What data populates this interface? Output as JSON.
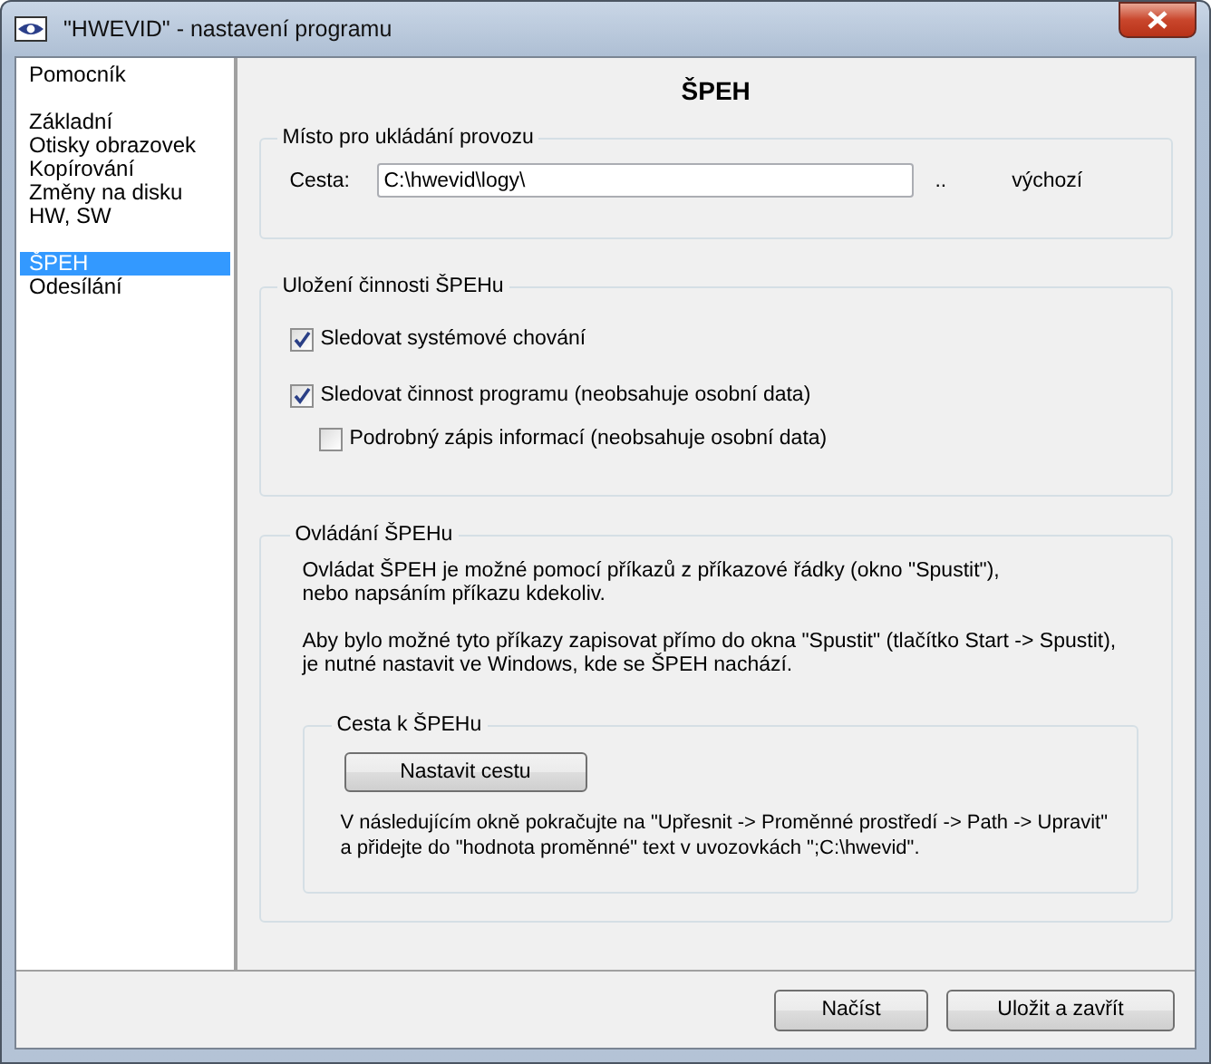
{
  "window": {
    "title": "\"HWEVID\" - nastavení programu"
  },
  "sidebar": {
    "groups": [
      [
        {
          "label": "Pomocník",
          "selected": false
        }
      ],
      [
        {
          "label": "Základní",
          "selected": false
        },
        {
          "label": "Otisky obrazovek",
          "selected": false
        },
        {
          "label": "Kopírování",
          "selected": false
        },
        {
          "label": "Změny na disku",
          "selected": false
        },
        {
          "label": "HW, SW",
          "selected": false
        }
      ],
      [
        {
          "label": "ŠPEH",
          "selected": true
        },
        {
          "label": "Odesílání",
          "selected": false
        }
      ]
    ]
  },
  "page_title": "ŠPEH",
  "storage": {
    "legend": "Místo pro ukládání provozu",
    "path_label": "Cesta:",
    "path_value": "C:\\hwevid\\logy\\",
    "browse": "..",
    "default": "výchozí"
  },
  "logging": {
    "legend": "Uložení činnosti ŠPEHu",
    "options": [
      {
        "label": "Sledovat systémové chování",
        "checked": true,
        "indented": false
      },
      {
        "label": "Sledovat činnost programu (neobsahuje osobní data)",
        "checked": true,
        "indented": false
      },
      {
        "label": "Podrobný zápis informací (neobsahuje osobní data)",
        "checked": false,
        "indented": true
      }
    ]
  },
  "control": {
    "legend": "Ovládání ŠPEHu",
    "paragraphs": [
      [
        "Ovládat ŠPEH je možné pomocí příkazů z příkazové řádky (okno \"Spustit\"),",
        "nebo napsáním příkazu kdekoliv."
      ],
      [
        "Aby bylo možné tyto příkazy zapisovat přímo do okna \"Spustit\" (tlačítko Start -> Spustit),",
        "je nutné nastavit ve Windows, kde se ŠPEH nachází."
      ]
    ],
    "path_box": {
      "legend": "Cesta k ŠPEHu",
      "button": "Nastavit cestu",
      "note": [
        "V následujícím okně pokračujte na \"Upřesnit -> Proměnné prostředí -> Path -> Upravit\"",
        "a přidejte do \"hodnota proměnné\" text v uvozovkách \";C:\\hwevid\"."
      ]
    }
  },
  "buttons": [
    "Načíst",
    "Uložit a zavřít"
  ]
}
